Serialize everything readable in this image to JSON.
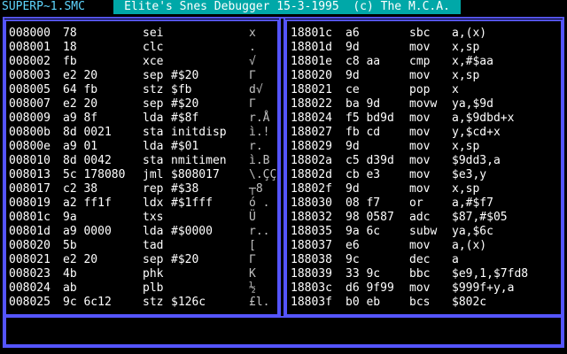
{
  "header": {
    "filename": "SUPERP~1.SMC",
    "title": "Elite's Snes Debugger 15-3-1995  (c) The M.C.A."
  },
  "colors": {
    "frame": "#5454fc",
    "title_bg": "#00a8a8",
    "filename": "#5fd7ff",
    "background": "#000000",
    "text": "#ffffff"
  },
  "left_rows": [
    {
      "addr": "008000",
      "bytes": "78",
      "op": "sei",
      "arg": "",
      "ascii": "x"
    },
    {
      "addr": "008001",
      "bytes": "18",
      "op": "clc",
      "arg": "",
      "ascii": "."
    },
    {
      "addr": "008002",
      "bytes": "fb",
      "op": "xce",
      "arg": "",
      "ascii": "√"
    },
    {
      "addr": "008003",
      "bytes": "e2 20",
      "op": "sep",
      "arg": "#$20",
      "ascii": "Γ"
    },
    {
      "addr": "008005",
      "bytes": "64 fb",
      "op": "stz",
      "arg": "$fb",
      "ascii": "d√"
    },
    {
      "addr": "008007",
      "bytes": "e2 20",
      "op": "sep",
      "arg": "#$20",
      "ascii": "Γ"
    },
    {
      "addr": "008009",
      "bytes": "a9 8f",
      "op": "lda",
      "arg": "#$8f",
      "ascii": "r.Å"
    },
    {
      "addr": "00800b",
      "bytes": "8d 0021",
      "op": "sta",
      "arg": "initdisp",
      "ascii": "ì.!"
    },
    {
      "addr": "00800e",
      "bytes": "a9 01",
      "op": "lda",
      "arg": "#$01",
      "ascii": "r."
    },
    {
      "addr": "008010",
      "bytes": "8d 0042",
      "op": "sta",
      "arg": "nmitimen",
      "ascii": "ì.B"
    },
    {
      "addr": "008013",
      "bytes": "5c 178080",
      "op": "jml",
      "arg": "$808017",
      "ascii": "\\.ÇÇ"
    },
    {
      "addr": "008017",
      "bytes": "c2 38",
      "op": "rep",
      "arg": "#$38",
      "ascii": "┬8"
    },
    {
      "addr": "008019",
      "bytes": "a2 ff1f",
      "op": "ldx",
      "arg": "#$1fff",
      "ascii": "ó ."
    },
    {
      "addr": "00801c",
      "bytes": "9a",
      "op": "txs",
      "arg": "",
      "ascii": "Ü"
    },
    {
      "addr": "00801d",
      "bytes": "a9 0000",
      "op": "lda",
      "arg": "#$0000",
      "ascii": "r.."
    },
    {
      "addr": "008020",
      "bytes": "5b",
      "op": "tad",
      "arg": "",
      "ascii": "["
    },
    {
      "addr": "008021",
      "bytes": "e2 20",
      "op": "sep",
      "arg": "#$20",
      "ascii": "Γ"
    },
    {
      "addr": "008023",
      "bytes": "4b",
      "op": "phk",
      "arg": "",
      "ascii": "K"
    },
    {
      "addr": "008024",
      "bytes": "ab",
      "op": "plb",
      "arg": "",
      "ascii": "½"
    },
    {
      "addr": "008025",
      "bytes": "9c 6c12",
      "op": "stz",
      "arg": "$126c",
      "ascii": "£l."
    }
  ],
  "right_rows": [
    {
      "addr": "18801c",
      "bytes": "a6",
      "op": "sbc",
      "arg": "a,(x)"
    },
    {
      "addr": "18801d",
      "bytes": "9d",
      "op": "mov",
      "arg": "x,sp"
    },
    {
      "addr": "18801e",
      "bytes": "c8 aa",
      "op": "cmp",
      "arg": "x,#$aa"
    },
    {
      "addr": "188020",
      "bytes": "9d",
      "op": "mov",
      "arg": "x,sp"
    },
    {
      "addr": "188021",
      "bytes": "ce",
      "op": "pop",
      "arg": "x"
    },
    {
      "addr": "188022",
      "bytes": "ba 9d",
      "op": "movw",
      "arg": "ya,$9d"
    },
    {
      "addr": "188024",
      "bytes": "f5 bd9d",
      "op": "mov",
      "arg": "a,$9dbd+x"
    },
    {
      "addr": "188027",
      "bytes": "fb cd",
      "op": "mov",
      "arg": "y,$cd+x"
    },
    {
      "addr": "188029",
      "bytes": "9d",
      "op": "mov",
      "arg": "x,sp"
    },
    {
      "addr": "18802a",
      "bytes": "c5 d39d",
      "op": "mov",
      "arg": "$9dd3,a"
    },
    {
      "addr": "18802d",
      "bytes": "cb e3",
      "op": "mov",
      "arg": "$e3,y"
    },
    {
      "addr": "18802f",
      "bytes": "9d",
      "op": "mov",
      "arg": "x,sp"
    },
    {
      "addr": "188030",
      "bytes": "08 f7",
      "op": "or",
      "arg": "a,#$f7"
    },
    {
      "addr": "188032",
      "bytes": "98 0587",
      "op": "adc",
      "arg": "$87,#$05"
    },
    {
      "addr": "188035",
      "bytes": "9a 6c",
      "op": "subw",
      "arg": "ya,$6c"
    },
    {
      "addr": "188037",
      "bytes": "e6",
      "op": "mov",
      "arg": "a,(x)"
    },
    {
      "addr": "188038",
      "bytes": "9c",
      "op": "dec",
      "arg": "a"
    },
    {
      "addr": "188039",
      "bytes": "33 9c",
      "op": "bbc",
      "arg": "$e9,1,$7fd8"
    },
    {
      "addr": "18803c",
      "bytes": "d6 9f99",
      "op": "mov",
      "arg": "$999f+y,a"
    },
    {
      "addr": "18803f",
      "bytes": "b0 eb",
      "op": "bcs",
      "arg": "$802c"
    }
  ],
  "command_line": ""
}
